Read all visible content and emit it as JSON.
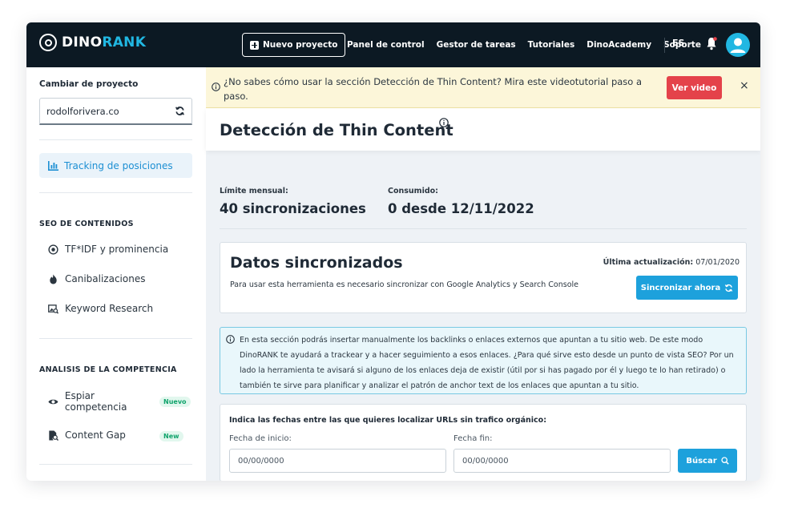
{
  "header": {
    "logo": {
      "text_main": "DINO",
      "text_accent": "RANK"
    },
    "new_project_label": "Nuevo proyecto",
    "nav": [
      "Panel de control",
      "Gestor de tareas",
      "Tutoriales",
      "DinoAcademy",
      "Soporte"
    ],
    "language": "ES",
    "colors": {
      "background": "#0c1923",
      "accent": "#21b7e2"
    }
  },
  "sidebar": {
    "project_label": "Cambiar de proyecto",
    "project_value": "rodolforivera.co",
    "active_item": {
      "label": "Tracking de posiciones",
      "icon": "bar-chart-icon"
    },
    "sections": [
      {
        "title": "SEO DE CONTENIDOS",
        "items": [
          {
            "label": "TF*IDF y prominencia",
            "icon": "target-icon"
          },
          {
            "label": "Canibalizaciones",
            "icon": "fire-icon"
          },
          {
            "label": "Keyword Research",
            "icon": "image-search-icon"
          }
        ]
      },
      {
        "title": "ANALISIS DE LA COMPETENCIA",
        "items": [
          {
            "label": "Espiar competencia",
            "icon": "eye-icon",
            "badge": "Nuevo"
          },
          {
            "label": "Content Gap",
            "icon": "file-search-icon",
            "badge": "New"
          }
        ]
      }
    ]
  },
  "banner": {
    "text": "¿No sabes cómo usar la sección Detección de Thin Content? Mira este videotutorial paso a paso.",
    "button": "Ver video",
    "close": "×",
    "color_button": "#e4424a"
  },
  "page": {
    "title": "Detección de Thin Content",
    "stats": [
      {
        "label": "Límite mensual:",
        "value": "40 sincronizaciones"
      },
      {
        "label": "Consumido:",
        "value": "0 desde 12/11/2022"
      }
    ]
  },
  "sync": {
    "title": "Datos sincronizados",
    "description": "Para usar esta herramienta es necesario sincronizar con Google Analytics y Search Console",
    "updated_label": "Última actualización:",
    "updated_value": "07/01/2020",
    "button": "Sincronizar ahora"
  },
  "info": {
    "text": "En esta sección podrás insertar manualmente los backlinks o enlaces externos que apuntan a tu sitio web. De este modo DinoRANK te ayudará a trackear y a hacer seguimiento a esos enlaces. ¿Para qué sirve esto desde un punto de vista SEO? Por un lado la herramienta te avisará si alguno de los enlaces deja de existir (útil por si has pagado por él y luego te lo han retirado) o también te sirve para planificar y analizar el patrón de anchor text de los enlaces que apuntan a tu sitio."
  },
  "dates": {
    "title": "Indica las fechas entre las que quieres localizar URLs sin trafico orgánico:",
    "start_label": "Fecha de inicio:",
    "start_placeholder": "00/00/0000",
    "end_label": "Fecha fin:",
    "end_placeholder": "00/00/0000",
    "button": "Búscar",
    "color_button": "#1da1dc"
  }
}
